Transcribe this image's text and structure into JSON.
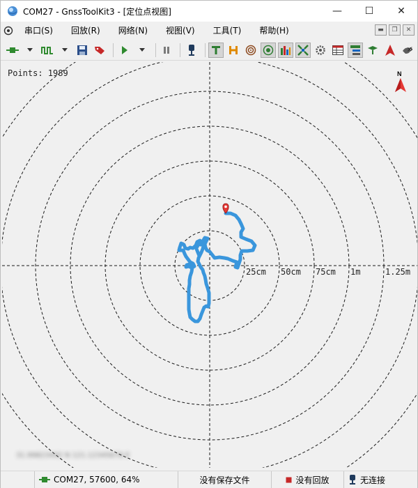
{
  "window": {
    "title": "COM27 - GnssToolKit3 - [定位点视图]",
    "minimize_glyph": "—",
    "maximize_glyph": "☐",
    "close_glyph": "✕"
  },
  "menu": {
    "items": [
      "串口(S)",
      "回放(R)",
      "网络(N)",
      "视图(V)",
      "工具(T)",
      "帮助(H)"
    ]
  },
  "toolbar": {
    "buttons": [
      {
        "name": "serial-connect-icon"
      },
      {
        "name": "dropdown-arrow-icon"
      },
      {
        "name": "signal-wave-icon"
      },
      {
        "name": "dropdown-arrow-icon"
      },
      {
        "name": "save-icon"
      },
      {
        "name": "tag-icon"
      },
      {
        "name": "play-icon"
      },
      {
        "name": "dropdown-arrow-icon"
      },
      {
        "name": "pause-icon"
      },
      {
        "name": "receiver-icon"
      },
      {
        "name": "text-view-icon",
        "pressed": true
      },
      {
        "name": "hex-view-icon"
      },
      {
        "name": "target-icon"
      },
      {
        "name": "position-view-icon",
        "pressed": true
      },
      {
        "name": "bar-chart-icon",
        "pressed": true
      },
      {
        "name": "satellite-icon",
        "pressed": true
      },
      {
        "name": "settings-icon"
      },
      {
        "name": "table-icon"
      },
      {
        "name": "tree-view-icon"
      },
      {
        "name": "antenna-icon"
      },
      {
        "name": "navigation-arrow-icon"
      },
      {
        "name": "bird-icon"
      }
    ],
    "overflow_glyph": "»"
  },
  "plot": {
    "points_label": "Points: 1989",
    "compass_letter": "N",
    "ring_labels": [
      "25cm",
      "50cm",
      "75cm",
      "1m",
      "1.25m"
    ],
    "blurred_text": "31.99823492 N 121.12345678 E",
    "track_color": "#3a96dc",
    "marker_color": "#e53935",
    "grid_color": "#1a1a1a",
    "trajectory_cm": [
      [
        11.5,
        37.5
      ],
      [
        15,
        37.5
      ],
      [
        18.5,
        36
      ],
      [
        21,
        33
      ],
      [
        22.5,
        30
      ],
      [
        24,
        26.5
      ],
      [
        22.5,
        24
      ],
      [
        22.5,
        20.5
      ],
      [
        26,
        19
      ],
      [
        30,
        17.5
      ],
      [
        32.5,
        14.5
      ],
      [
        31,
        11
      ],
      [
        27,
        10.5
      ],
      [
        23,
        10.5
      ],
      [
        22,
        7.5
      ],
      [
        22,
        4.5
      ],
      [
        21,
        1.5
      ],
      [
        20,
        -1.5
      ],
      [
        18.5,
        -1
      ],
      [
        19.5,
        2.5
      ],
      [
        16.5,
        3.5
      ],
      [
        13,
        5
      ],
      [
        10.5,
        5.5
      ],
      [
        7,
        6
      ],
      [
        3.5,
        5.5
      ],
      [
        2,
        7.5
      ],
      [
        0,
        10
      ],
      [
        -2,
        11
      ],
      [
        -3,
        13
      ],
      [
        -3.5,
        15.5
      ],
      [
        -2.5,
        17.5
      ],
      [
        -1.5,
        19.5
      ],
      [
        -3.5,
        20
      ],
      [
        -5,
        17.5
      ],
      [
        -6.5,
        15
      ],
      [
        -8,
        15.5
      ],
      [
        -9,
        13.5
      ],
      [
        -10.5,
        14
      ],
      [
        -12,
        12.5
      ],
      [
        -14,
        13
      ],
      [
        -15.5,
        12
      ],
      [
        -17.5,
        12.5
      ],
      [
        -18.5,
        15
      ],
      [
        -20.5,
        16
      ],
      [
        -21.5,
        13
      ],
      [
        -22,
        11
      ],
      [
        -19,
        11
      ],
      [
        -18,
        8.5
      ],
      [
        -17,
        6.5
      ],
      [
        -15.5,
        4.5
      ],
      [
        -14,
        2.5
      ],
      [
        -12,
        1.5
      ],
      [
        -11,
        -0.5
      ],
      [
        -13,
        -1.5
      ],
      [
        -15,
        -0.5
      ],
      [
        -17,
        -1
      ],
      [
        -16.5,
        0.5
      ],
      [
        -14.5,
        1
      ],
      [
        -12.5,
        -1.5
      ],
      [
        -13,
        -4.5
      ],
      [
        -14,
        -7.5
      ],
      [
        -14.5,
        -10.5
      ],
      [
        -14.5,
        -13.5
      ],
      [
        -15,
        -16.5
      ],
      [
        -15,
        -19.5
      ],
      [
        -15,
        -22.5
      ],
      [
        -15,
        -25.5
      ],
      [
        -15,
        -28.5
      ],
      [
        -15,
        -31.5
      ],
      [
        -14.5,
        -34.5
      ],
      [
        -14,
        -37
      ],
      [
        -12.5,
        -38.5
      ],
      [
        -10.5,
        -40
      ],
      [
        -8.5,
        -40
      ],
      [
        -7,
        -38
      ],
      [
        -6,
        -35
      ],
      [
        -5,
        -32.5
      ],
      [
        -4,
        -30
      ],
      [
        -2.5,
        -29
      ],
      [
        -1,
        -29.5
      ],
      [
        -0.5,
        -27
      ],
      [
        -0.5,
        -23.5
      ],
      [
        -0.5,
        -19.5
      ],
      [
        -1.5,
        -16
      ],
      [
        -2.5,
        -13
      ],
      [
        -3,
        -10
      ],
      [
        -3.5,
        -7.5
      ],
      [
        -4.5,
        -5
      ],
      [
        -5,
        -3
      ],
      [
        -6.5,
        -1
      ],
      [
        -7.5,
        1
      ],
      [
        -8.5,
        3
      ],
      [
        -8,
        5.5
      ],
      [
        -7,
        7.5
      ],
      [
        -6,
        9.5
      ],
      [
        -5,
        12
      ],
      [
        -4.5,
        14
      ],
      [
        -5.5,
        16.5
      ],
      [
        -7,
        18
      ],
      [
        -9,
        17
      ],
      [
        -10,
        14.5
      ],
      [
        -9.5,
        12
      ],
      [
        -8.5,
        9.5
      ],
      [
        -7.5,
        7
      ]
    ],
    "marker_cm": [
      11.5,
      37.5
    ]
  },
  "status": {
    "port": "COM27, 57600, 64%",
    "file": "没有保存文件",
    "playback": "没有回放",
    "connection": "无连接"
  }
}
